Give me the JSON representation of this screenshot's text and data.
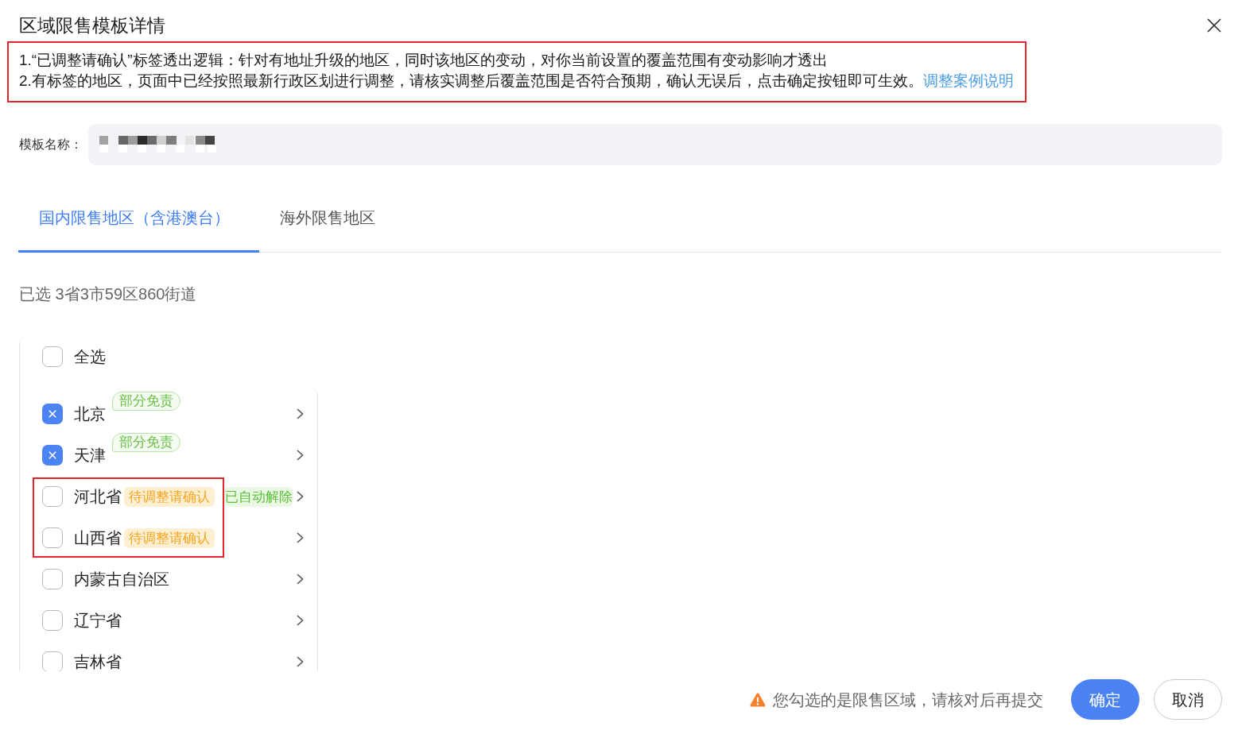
{
  "dialog": {
    "title": "区域限售模板详情"
  },
  "notice": {
    "highlighted": true,
    "lines": [
      {
        "text": "1.“已调整请确认”标签透出逻辑：针对有地址升级的地区，同时该地区的变动，对你当前设置的覆盖范围有变动影响才透出"
      },
      {
        "text": "2.有标签的地区，页面中已经按照最新行政区划进行调整，请核实调整后覆盖范围是否符合预期，确认无误后，点击确定按钮即可生效。",
        "link": "调整案例说明"
      }
    ]
  },
  "template_name": {
    "label": "模板名称："
  },
  "tabs": [
    {
      "label": "国内限售地区（含港澳台）",
      "selected": true
    },
    {
      "label": "海外限售地区",
      "selected": false
    }
  ],
  "selection_summary": "已选 3省3市59区860街道",
  "select_all": {
    "label": "全选",
    "checked": false
  },
  "regions": [
    {
      "name": "北京",
      "checked": true,
      "highlighted": false,
      "tags": [
        {
          "text": "部分免责",
          "kind": "exemption"
        }
      ]
    },
    {
      "name": "天津",
      "checked": true,
      "highlighted": false,
      "tags": [
        {
          "text": "部分免责",
          "kind": "exemption"
        }
      ]
    },
    {
      "name": "河北省",
      "checked": false,
      "highlighted": true,
      "tags": [
        {
          "text": "待调整请确认",
          "kind": "pending"
        },
        {
          "text": "已自动解除",
          "kind": "released"
        }
      ]
    },
    {
      "name": "山西省",
      "checked": false,
      "highlighted": true,
      "tags": [
        {
          "text": "待调整请确认",
          "kind": "pending"
        }
      ]
    },
    {
      "name": "内蒙古自治区",
      "checked": false,
      "highlighted": false
    },
    {
      "name": "辽宁省",
      "checked": false,
      "highlighted": false
    },
    {
      "name": "吉林省",
      "checked": false,
      "highlighted": false
    }
  ],
  "warning": {
    "text": "您勾选的是限售区域，请核对后再提交"
  },
  "buttons": [
    {
      "label": "确定",
      "kind": "primary"
    },
    {
      "label": "取消",
      "kind": "secondary"
    }
  ]
}
